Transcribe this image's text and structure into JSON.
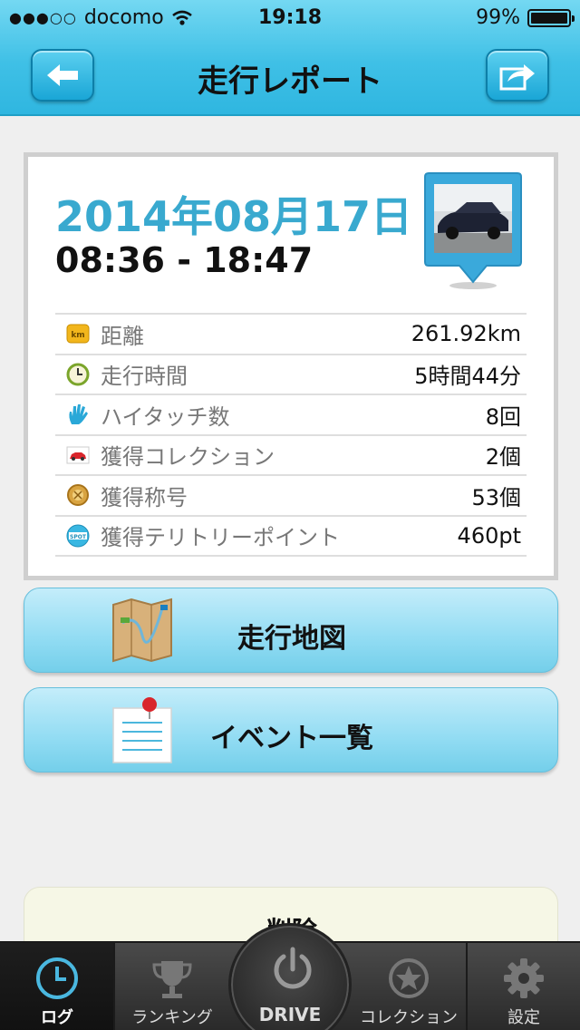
{
  "status_bar": {
    "carrier": "docomo",
    "time": "19:18",
    "battery_percent": "99%",
    "battery_level": 0.99,
    "signal_icon": "signal-dots-icon",
    "wifi_icon": "wifi-icon"
  },
  "nav": {
    "title": "走行レポート",
    "back_icon": "back-arrow-icon",
    "share_icon": "share-icon"
  },
  "report": {
    "date": "2014年08月17日",
    "time_range": "08:36 - 18:47",
    "photo_icon": "car-photo-pin-icon",
    "stats": [
      {
        "icon": "distance-km-icon",
        "label": "距離",
        "value": "261.92km"
      },
      {
        "icon": "clock-icon",
        "label": "走行時間",
        "value": "5時間44分"
      },
      {
        "icon": "hi-five-hand-icon",
        "label": "ハイタッチ数",
        "value": "8回"
      },
      {
        "icon": "car-card-icon",
        "label": "獲得コレクション",
        "value": "2個"
      },
      {
        "icon": "title-medal-icon",
        "label": "獲得称号",
        "value": "53個"
      },
      {
        "icon": "spot-territory-icon",
        "label": "獲得テリトリーポイント",
        "value": "460pt"
      }
    ]
  },
  "actions": {
    "map_label": "走行地図",
    "map_icon": "route-map-icon",
    "events_label": "イベント一覧",
    "events_icon": "event-list-memo-icon"
  },
  "delete_label": "削除",
  "tabs": {
    "log": "ログ",
    "ranking": "ランキング",
    "drive": "DRIVE",
    "collection": "コレクション",
    "settings": "設定"
  },
  "colors": {
    "accent": "#39a9cf",
    "nav_bar": "#3fc0e6",
    "button_light": "#92dcf3",
    "tab_active": "#4ab8e0"
  }
}
